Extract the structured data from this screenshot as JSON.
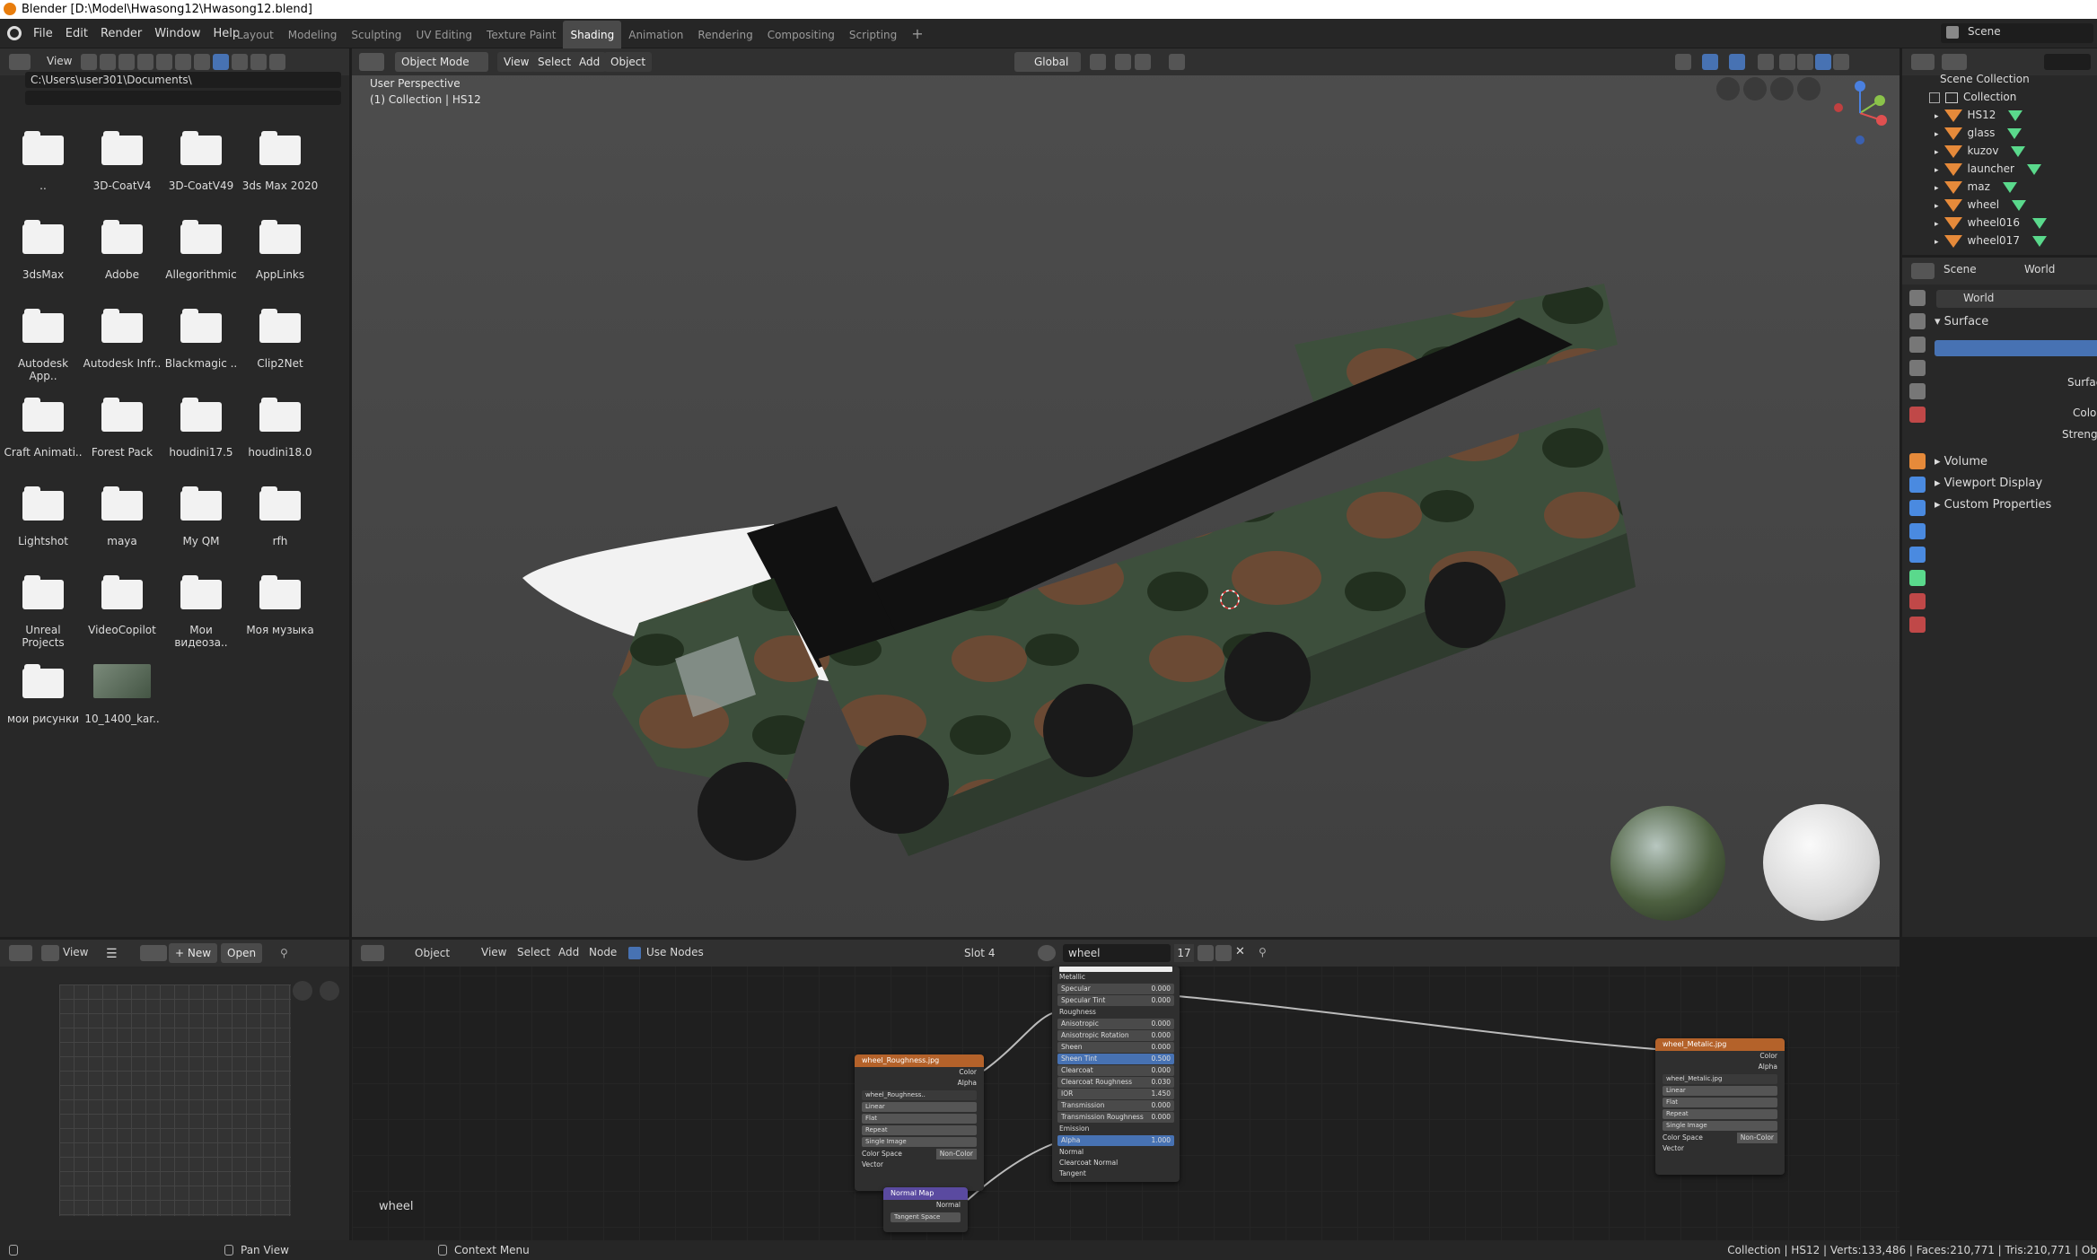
{
  "title": "Blender [D:\\Model\\Hwasong12\\Hwasong12.blend]",
  "menus": [
    "File",
    "Edit",
    "Render",
    "Window",
    "Help"
  ],
  "workspaces": [
    "Layout",
    "Modeling",
    "Sculpting",
    "UV Editing",
    "Texture Paint",
    "Shading",
    "Animation",
    "Rendering",
    "Compositing",
    "Scripting"
  ],
  "active_workspace": "Shading",
  "scene_label": "Scene",
  "filebrowser": {
    "view_label": "View",
    "path": "C:\\Users\\user301\\Documents\\",
    "items": [
      "..",
      "3D-CoatV4",
      "3D-CoatV49",
      "3ds Max 2020",
      "3dsMax",
      "Adobe",
      "Allegorithmic",
      "AppLinks",
      "Autodesk App..",
      "Autodesk Infr..",
      "Blackmagic ..",
      "Clip2Net",
      "Craft Animati..",
      "Forest Pack",
      "houdini17.5",
      "houdini18.0",
      "Lightshot",
      "maya",
      "My QM",
      "rfh",
      "Unreal Projects",
      "VideoCopilot",
      "Мои видеоза..",
      "Моя музыка",
      "мои рисунки",
      "10_1400_kar.."
    ]
  },
  "viewport": {
    "mode": "Object Mode",
    "menus": [
      "View",
      "Select",
      "Add",
      "Object"
    ],
    "orientation": "Global",
    "info_line1": "User Perspective",
    "info_line2": "(1) Collection | HS12"
  },
  "outliner": {
    "root": "Scene Collection",
    "collection": "Collection",
    "objects": [
      "HS12",
      "glass",
      "kuzov",
      "launcher",
      "maz",
      "wheel",
      "wheel016",
      "wheel017"
    ]
  },
  "properties": {
    "scene_tab": "Scene",
    "world_tab": "World",
    "world_name": "World",
    "surface_panel": "Surface",
    "surface_label": "Surfac",
    "color_label": "Colo",
    "strength_label": "Strengt",
    "panels": [
      "Volume",
      "Viewport Display",
      "Custom Properties"
    ]
  },
  "image_editor": {
    "view_label": "View",
    "new_label": "New",
    "open_label": "Open"
  },
  "node_editor": {
    "object_label": "Object",
    "menus": [
      "View",
      "Select",
      "Add",
      "Node"
    ],
    "use_nodes": "Use Nodes",
    "slot": "Slot 4",
    "material": "wheel",
    "users": "17",
    "footer_material": "wheel",
    "bsdf_rows": [
      {
        "label": "Metallic",
        "value": ""
      },
      {
        "label": "Specular",
        "value": "0.000"
      },
      {
        "label": "Specular Tint",
        "value": "0.000"
      },
      {
        "label": "Roughness",
        "value": ""
      },
      {
        "label": "Anisotropic",
        "value": "0.000"
      },
      {
        "label": "Anisotropic Rotation",
        "value": "0.000"
      },
      {
        "label": "Sheen",
        "value": "0.000"
      },
      {
        "label": "Sheen Tint",
        "value": "0.500"
      },
      {
        "label": "Clearcoat",
        "value": "0.000"
      },
      {
        "label": "Clearcoat Roughness",
        "value": "0.030"
      },
      {
        "label": "IOR",
        "value": "1.450"
      },
      {
        "label": "Transmission",
        "value": "0.000"
      },
      {
        "label": "Transmission Roughness",
        "value": "0.000"
      },
      {
        "label": "Emission",
        "value": ""
      },
      {
        "label": "Alpha",
        "value": "1.000"
      },
      {
        "label": "Normal",
        "value": ""
      },
      {
        "label": "Clearcoat Normal",
        "value": ""
      },
      {
        "label": "Tangent",
        "value": ""
      }
    ],
    "rough_node": {
      "title": "wheel_Roughness.jpg",
      "out1": "Color",
      "out2": "Alpha",
      "image": "wheel_Roughness..",
      "interp": "Linear",
      "proj": "Flat",
      "ext": "Repeat",
      "src": "Single Image",
      "cs_label": "Color Space",
      "cs_value": "Non-Color",
      "input": "Vector"
    },
    "metal_node": {
      "title": "wheel_Metalic.jpg",
      "out1": "Color",
      "out2": "Alpha",
      "image": "wheel_Metalic.jpg",
      "interp": "Linear",
      "proj": "Flat",
      "ext": "Repeat",
      "src": "Single Image",
      "cs_label": "Color Space",
      "cs_value": "Non-Color",
      "input": "Vector"
    },
    "normal_node": {
      "title": "Normal Map",
      "out": "Normal",
      "space": "Tangent Space"
    }
  },
  "statusbar": {
    "pan": "Pan View",
    "context": "Context Menu",
    "stats": "Collection | HS12 | Verts:133,486 | Faces:210,771 | Tris:210,771 | Ob"
  },
  "colors": {
    "accent_blue": "#4772b3",
    "texture_header": "#b4622a",
    "vector_header": "#5a4aa0",
    "object_orange": "#e68a3a",
    "mesh_green": "#5ad98c"
  }
}
